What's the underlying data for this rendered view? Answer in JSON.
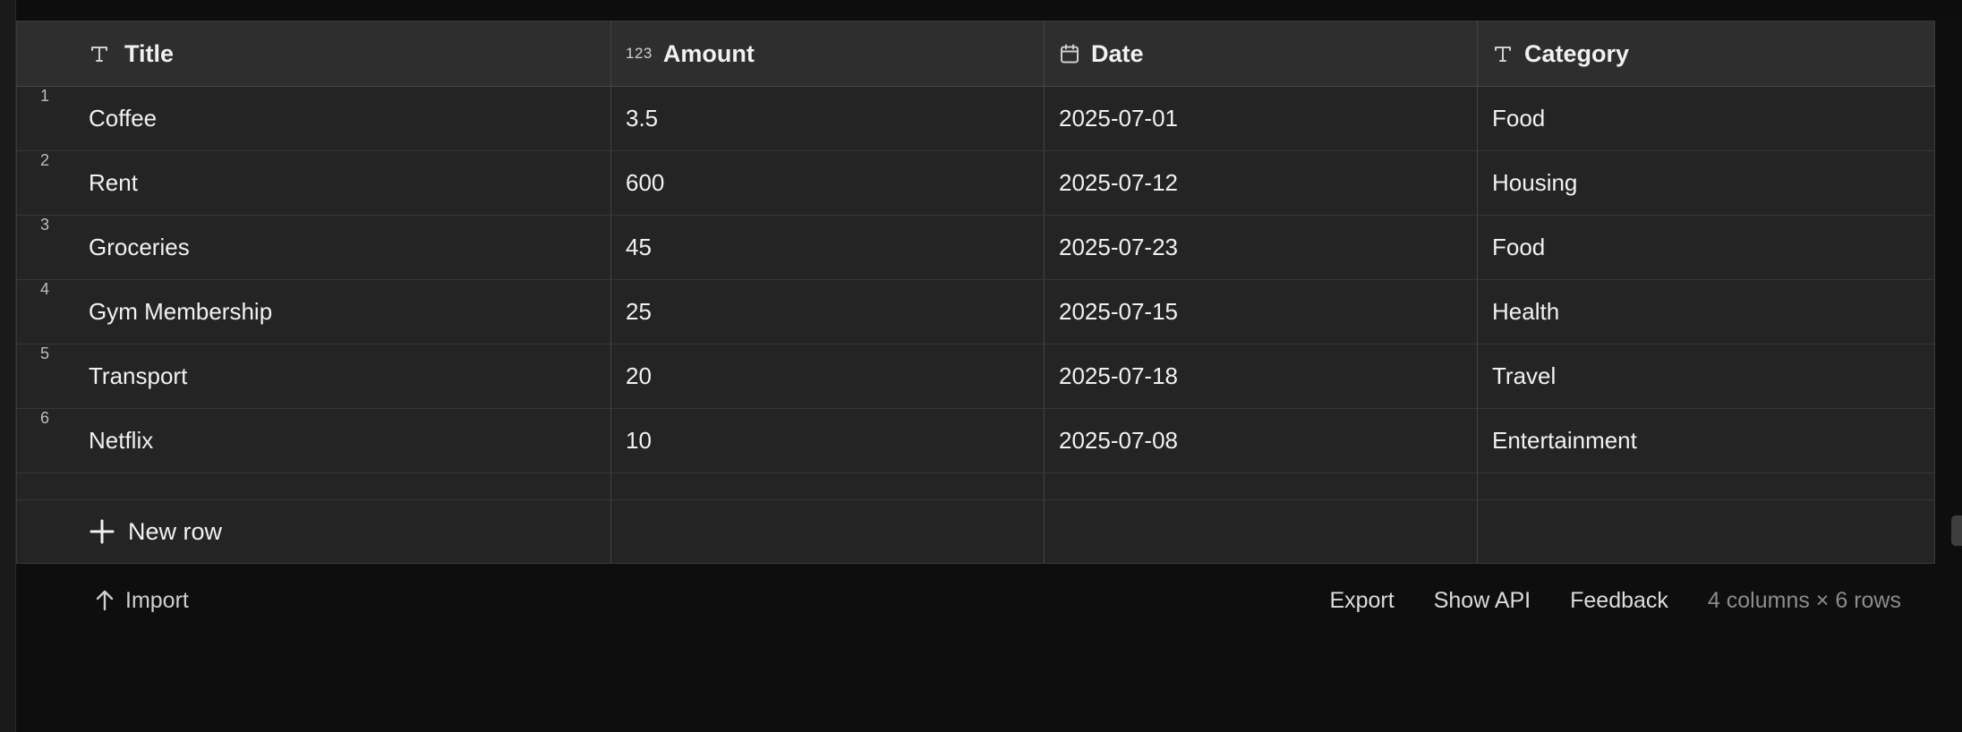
{
  "columns": [
    {
      "label": "Title",
      "icon": "text-type-icon"
    },
    {
      "label": "Amount",
      "icon": "number-type-icon",
      "icon_text": "123"
    },
    {
      "label": "Date",
      "icon": "calendar-icon"
    },
    {
      "label": "Category",
      "icon": "text-type-icon"
    }
  ],
  "rows": [
    {
      "num": "1",
      "title": "Coffee",
      "amount": "3.5",
      "date": "2025-07-01",
      "category": "Food"
    },
    {
      "num": "2",
      "title": "Rent",
      "amount": "600",
      "date": "2025-07-12",
      "category": "Housing"
    },
    {
      "num": "3",
      "title": "Groceries",
      "amount": "45",
      "date": "2025-07-23",
      "category": "Food"
    },
    {
      "num": "4",
      "title": "Gym Membership",
      "amount": "25",
      "date": "2025-07-15",
      "category": "Health"
    },
    {
      "num": "5",
      "title": "Transport",
      "amount": "20",
      "date": "2025-07-18",
      "category": "Travel"
    },
    {
      "num": "6",
      "title": "Netflix",
      "amount": "10",
      "date": "2025-07-08",
      "category": "Entertainment"
    }
  ],
  "new_row_label": "New row",
  "footer": {
    "import_label": "Import",
    "export_label": "Export",
    "show_api_label": "Show API",
    "feedback_label": "Feedback",
    "summary": "4 columns × 6 rows"
  }
}
